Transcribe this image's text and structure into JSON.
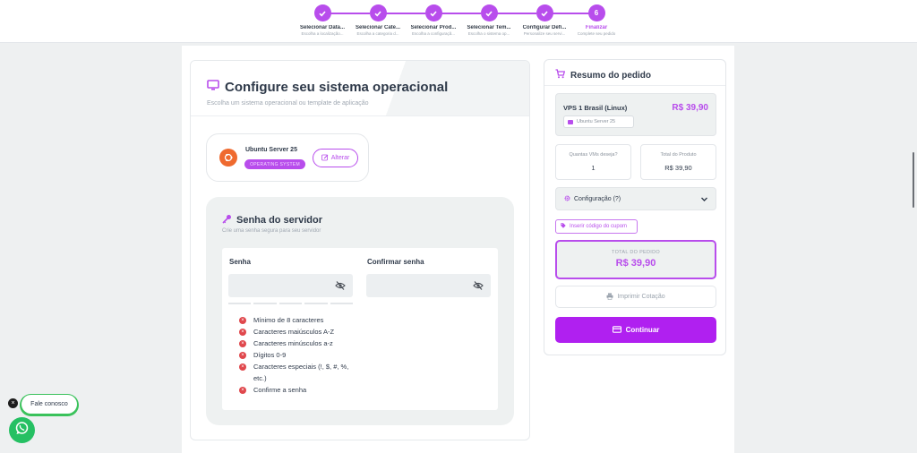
{
  "stepper": {
    "steps": [
      {
        "title": "Selecionar Data...",
        "sub": "Escolha a localização...",
        "state": "done"
      },
      {
        "title": "Selecionar Cate...",
        "sub": "Escolha a categoria d...",
        "state": "done"
      },
      {
        "title": "Selecionar Prod...",
        "sub": "Escolha a configuraçã...",
        "state": "done"
      },
      {
        "title": "Selecionar Tem...",
        "sub": "Escolha o sistema op...",
        "state": "done"
      },
      {
        "title": "Configurar Defi...",
        "sub": "Personalize seu servi...",
        "state": "done"
      },
      {
        "title": "Finalizar",
        "sub": "Complete seu pedido",
        "state": "active",
        "number": "6"
      }
    ],
    "accent": "#b84dec"
  },
  "os_section": {
    "title": "Configure seu sistema operacional",
    "subtitle": "Escolha um sistema operacional ou template de aplicação",
    "os_name": "Ubuntu Server 25",
    "os_badge": "OPERATING SYSTEM",
    "change_label": "Alterar"
  },
  "password_section": {
    "title": "Senha do servidor",
    "subtitle": "Crie uma senha segura para seu servidor",
    "password_label": "Senha",
    "confirm_label": "Confirmar senha",
    "password_value": "",
    "confirm_value": "",
    "requirements": [
      "Mínimo de 8 caracteres",
      "Caracteres maiúsculos A-Z",
      "Caracteres minúsculos a-z",
      "Dígitos 0-9",
      "Caracteres especiais (!, $, #, %, etc.)",
      "Confirme a senha"
    ]
  },
  "summary": {
    "title": "Resumo do pedido",
    "product_name": "VPS 1 Brasil (Linux)",
    "product_price": "R$ 39,90",
    "product_tag": "Ubuntu Server 25",
    "qty_label": "Quantas VMs deseja?",
    "qty_value": "1",
    "total_product_label": "Total do Produto",
    "total_product_value": "R$ 39,90",
    "config_label": "Configuração (?)",
    "coupon_label": "Inserir código do cupom",
    "order_total_label": "TOTAL DO PEDIDO",
    "order_total_value": "R$ 39,90",
    "print_label": "Imprimir Cotação",
    "continue_label": "Continuar"
  },
  "chat": {
    "close_glyph": "×",
    "pill_label": "Fale conosco"
  },
  "colors": {
    "accent": "#b84dec",
    "primary_button": "#b020f0",
    "error": "#e0474c",
    "whatsapp": "#25c063"
  },
  "icons": [
    "check-icon",
    "monitor-icon",
    "ubuntu-icon",
    "edit-icon",
    "key-icon",
    "eye-off-icon",
    "close-circle-icon",
    "cart-icon",
    "server-icon",
    "gear-icon",
    "chevron-down-icon",
    "tag-icon",
    "printer-icon",
    "card-icon",
    "whatsapp-icon"
  ]
}
